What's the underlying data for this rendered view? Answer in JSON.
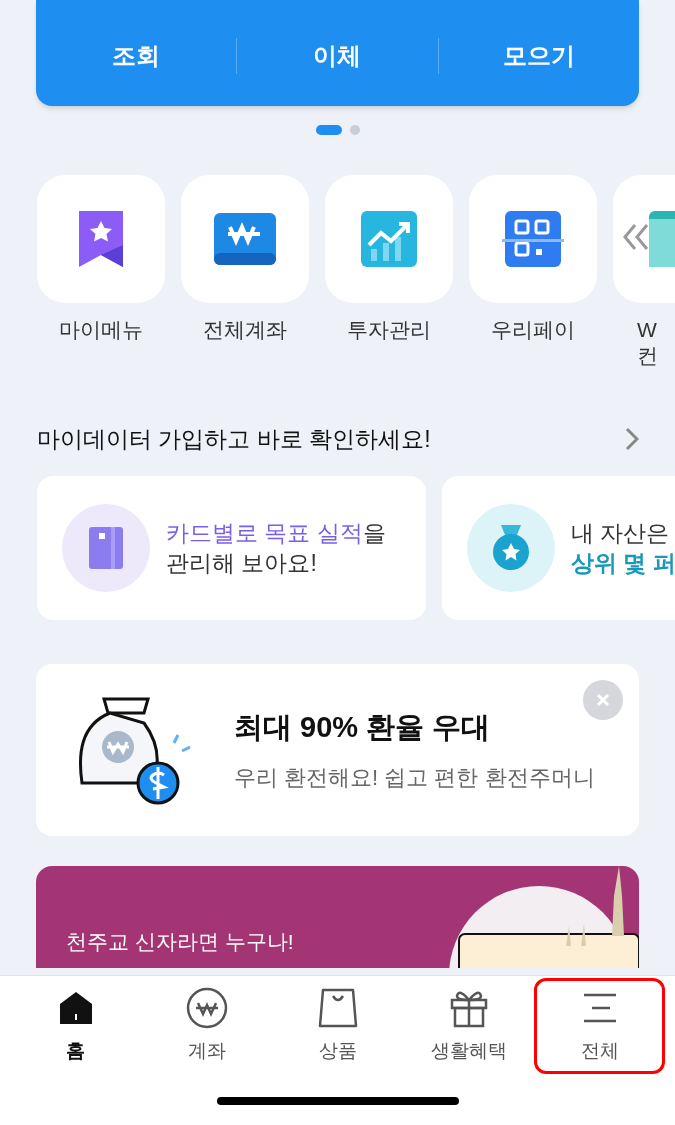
{
  "account_card": {
    "actions": [
      "조회",
      "이체",
      "모으기"
    ]
  },
  "pager": [
    {
      "selected": true
    },
    {
      "selected": false
    }
  ],
  "quick_menu": [
    {
      "kind": "bookmark",
      "label": [
        "마이메뉴"
      ]
    },
    {
      "kind": "wallet",
      "label": [
        "전체계좌"
      ]
    },
    {
      "kind": "chart",
      "label": [
        "투자관리"
      ]
    },
    {
      "kind": "qr",
      "label": [
        "우리페이"
      ]
    },
    {
      "kind": "partial",
      "label": [
        "W",
        "컨"
      ]
    }
  ],
  "mydata": {
    "title": "마이데이터 가입하고 바로 확인하세요!",
    "cards": [
      {
        "kind": "card",
        "lines": [
          [
            {
              "text": "카드별로 목표 실적",
              "accent": true
            },
            {
              "text": "을",
              "accent": false
            }
          ],
          [
            {
              "text": "관리해 보아요!",
              "accent": false
            }
          ]
        ]
      },
      {
        "kind": "medal",
        "lines": [
          [
            {
              "text": "내 자산은",
              "accent": false
            }
          ],
          [
            {
              "text": "상위 몇 퍼",
              "accent": true
            }
          ]
        ]
      }
    ]
  },
  "promo": {
    "title": "최대 90% 환율 우대",
    "subtitle": "우리 환전해요! 쉽고 편한 환전주머니"
  },
  "banner": {
    "text": "천주교 신자라면 누구나!"
  },
  "bottom_nav": [
    {
      "kind": "home",
      "label": "홈",
      "selected": true,
      "highlighted": false
    },
    {
      "kind": "won",
      "label": "계좌",
      "selected": false,
      "highlighted": false
    },
    {
      "kind": "bag",
      "label": "상품",
      "selected": false,
      "highlighted": false
    },
    {
      "kind": "gift",
      "label": "생활혜택",
      "selected": false,
      "highlighted": false
    },
    {
      "kind": "menu",
      "label": "전체",
      "selected": false,
      "highlighted": true
    }
  ]
}
